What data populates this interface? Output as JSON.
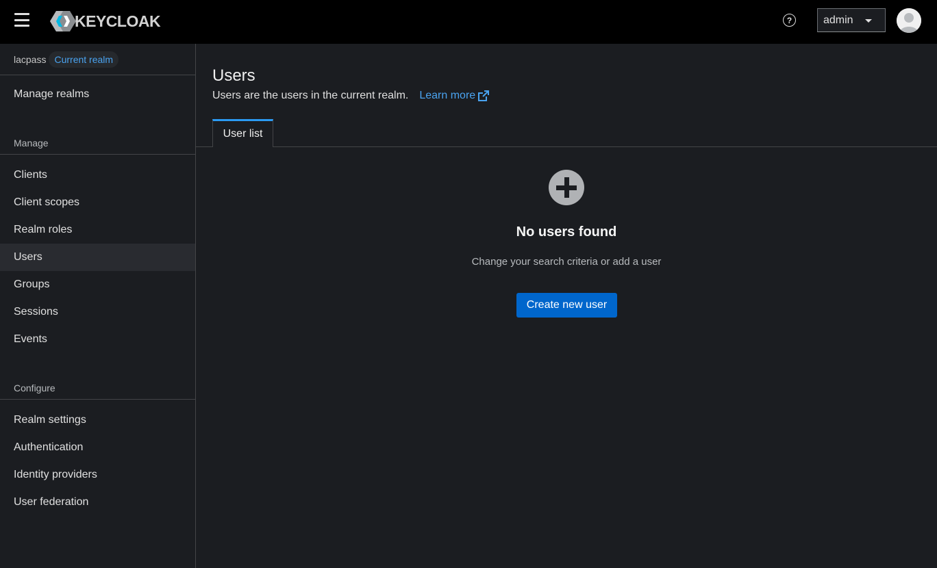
{
  "header": {
    "brand": "KEYCLOAK",
    "help_icon": "help-circle-icon",
    "user_menu_label": "admin"
  },
  "sidebar": {
    "realm_name": "lacpass",
    "realm_badge": "Current realm",
    "manage_realms": "Manage realms",
    "sections": [
      {
        "title": "Manage",
        "items": [
          {
            "label": "Clients"
          },
          {
            "label": "Client scopes"
          },
          {
            "label": "Realm roles"
          },
          {
            "label": "Users",
            "active": true
          },
          {
            "label": "Groups"
          },
          {
            "label": "Sessions"
          },
          {
            "label": "Events"
          }
        ]
      },
      {
        "title": "Configure",
        "items": [
          {
            "label": "Realm settings"
          },
          {
            "label": "Authentication"
          },
          {
            "label": "Identity providers"
          },
          {
            "label": "User federation"
          }
        ]
      }
    ]
  },
  "main": {
    "title": "Users",
    "description": "Users are the users in the current realm.",
    "learn_more": "Learn more",
    "tabs": [
      {
        "label": "User list",
        "active": true
      }
    ],
    "empty_state": {
      "icon": "plus-circle-icon",
      "title": "No users found",
      "body": "Change your search criteria or add a user",
      "button": "Create new user"
    }
  },
  "colors": {
    "accent": "#0066cc",
    "link": "#4aa3f0",
    "tab_active": "#2b9af3",
    "background": "#1b1d21",
    "header": "#000000"
  }
}
